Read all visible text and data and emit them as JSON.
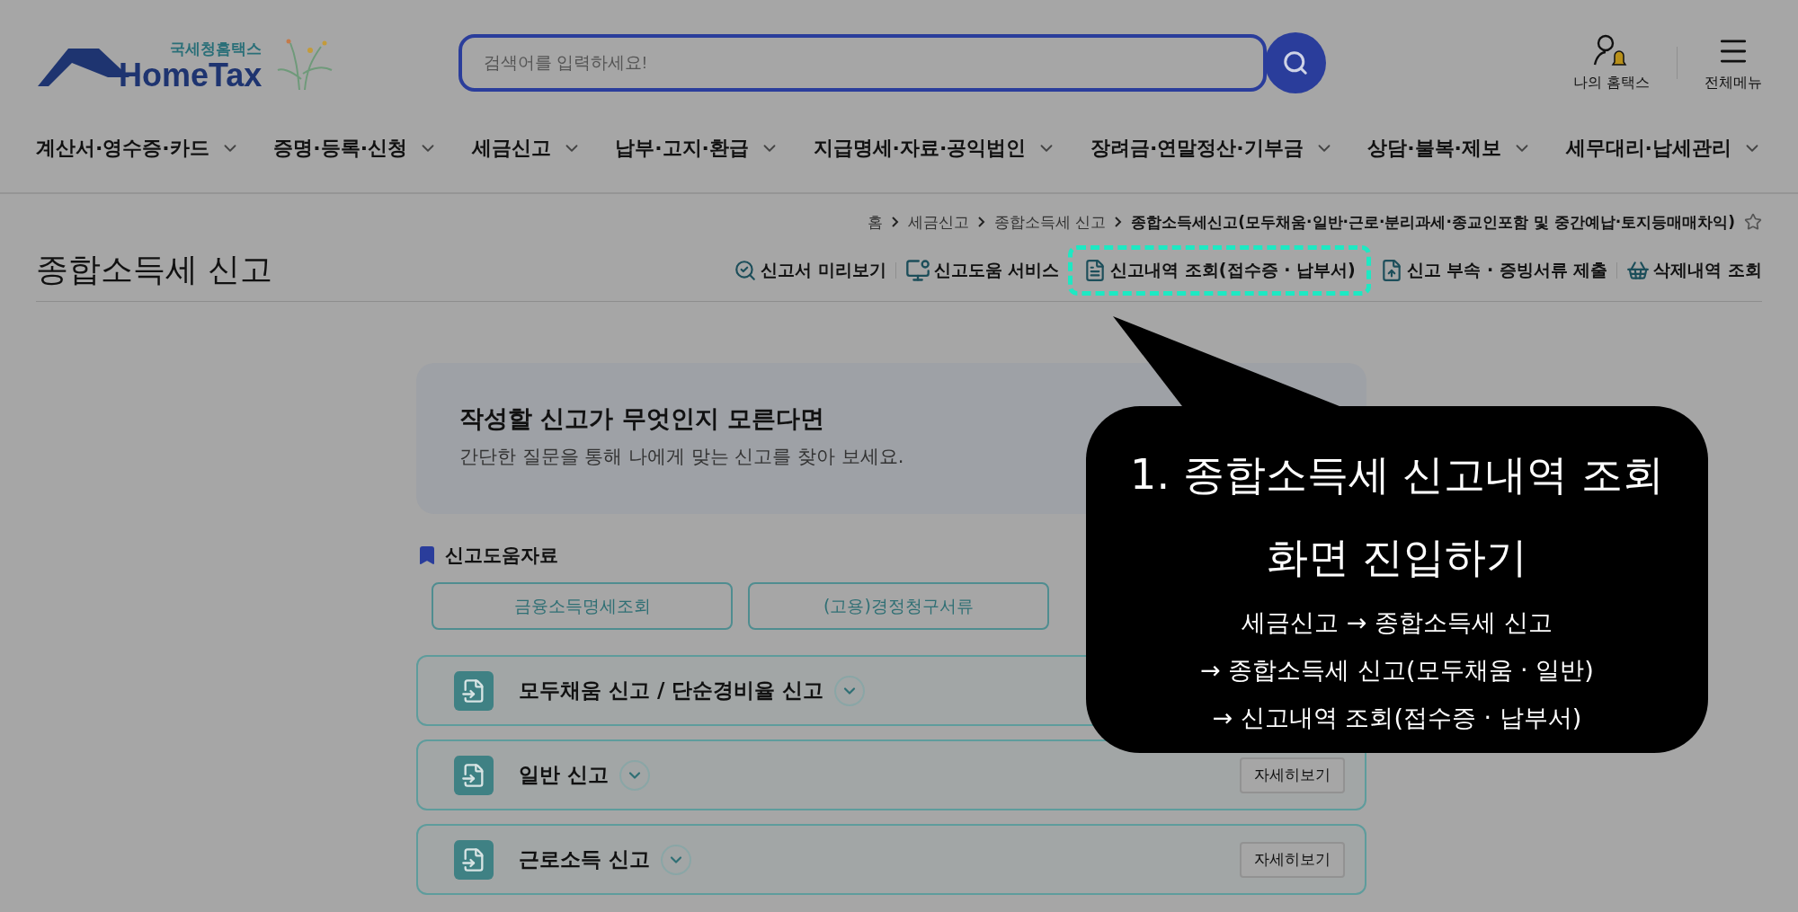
{
  "header": {
    "logo": {
      "subtitle": "국세청홈택스",
      "name": "HomeTax"
    },
    "search": {
      "placeholder": "검색어를 입력하세요!"
    },
    "utilities": [
      {
        "kind": "account",
        "label": "나의 홈택스"
      },
      {
        "kind": "menu",
        "label": "전체메뉴"
      }
    ],
    "nav": [
      "계산서·영수증·카드",
      "증명·등록·신청",
      "세금신고",
      "납부·고지·환급",
      "지급명세·자료·공익법인",
      "장려금·연말정산·기부금",
      "상담·불복·제보",
      "세무대리·납세관리"
    ]
  },
  "breadcrumb": [
    "홈",
    "세금신고",
    "종합소득세 신고",
    "종합소득세신고(모두채움·일반·근로·분리과세·종교인포함 및 중간예납·토지등매매차익)"
  ],
  "page_title": "종합소득세 신고",
  "toolbar": [
    {
      "kind": "preview",
      "label": "신고서 미리보기",
      "highlighted": false
    },
    {
      "kind": "help",
      "label": "신고도움 서비스",
      "highlighted": false
    },
    {
      "kind": "history",
      "label": "신고내역 조회(접수증 · 납부서)",
      "highlighted": true
    },
    {
      "kind": "upload",
      "label": "신고 부속 · 증빙서류 제출",
      "highlighted": false
    },
    {
      "kind": "basket",
      "label": "삭제내역 조회",
      "highlighted": false
    }
  ],
  "guide_card": {
    "title": "작성할 신고가 무엇인지 모른다면",
    "text": "간단한 질문을 통해 나에게 맞는 신고를 찾아 보세요."
  },
  "help_section": {
    "title": "신고도움자료",
    "buttons": [
      "금융소득명세조회",
      "(고용)경정청구서류"
    ]
  },
  "reports": [
    {
      "title": "모두채움 신고 / 단순경비율 신고"
    },
    {
      "title": "일반 신고",
      "detail_button": "자세히보기"
    },
    {
      "title": "근로소득 신고",
      "detail_button": "자세히보기"
    }
  ],
  "callout": {
    "title_lines": [
      "1. 종합소득세 신고내역 조회",
      "화면 진입하기"
    ],
    "steps": [
      "세금신고 → 종합소득세 신고",
      "→ 종합소득세 신고(모두채움 · 일반)",
      "→ 신고내역 조회(접수증 · 납부서)"
    ]
  }
}
